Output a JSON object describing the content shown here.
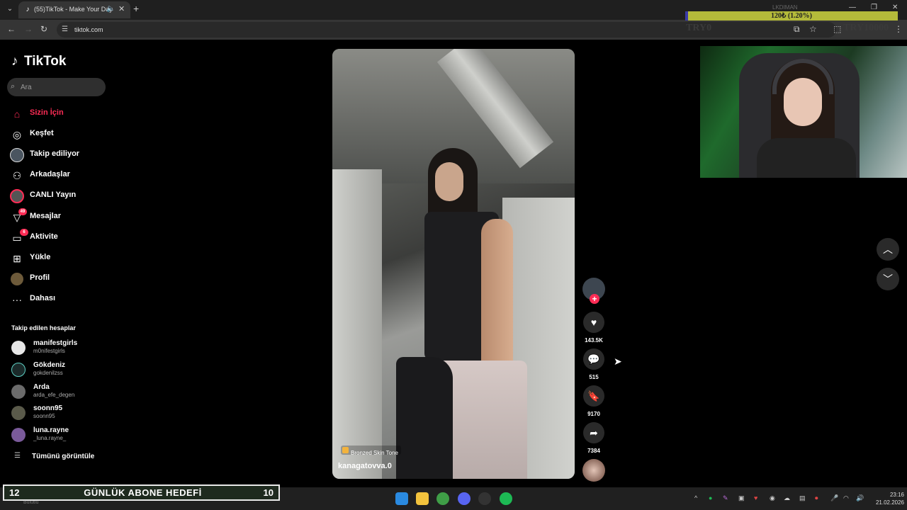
{
  "browser": {
    "tab_title": "(55)TikTok - Make Your Day",
    "url": "tiktok.com",
    "new_tab": "+",
    "minimize": "—",
    "maximize": "❐",
    "close": "✕"
  },
  "overlay": {
    "goal_label": "120₺ (1.20%)",
    "goal_progress": 0.012,
    "goal_top_label": "LKDIMAN",
    "goal_start": "TRY0",
    "goal_end": "TRY10000"
  },
  "sidebar": {
    "logo_text": "TikTok",
    "search_placeholder": "Ara",
    "nav": [
      {
        "label": "Sizin İçin",
        "icon": "home-icon",
        "active": true
      },
      {
        "label": "Keşfet",
        "icon": "compass-icon"
      },
      {
        "label": "Takip ediliyor",
        "icon": "following-avatar-icon"
      },
      {
        "label": "Arkadaşlar",
        "icon": "friends-icon"
      },
      {
        "label": "CANLI Yayın",
        "icon": "live-icon"
      },
      {
        "label": "Mesajlar",
        "icon": "messages-icon",
        "badge": "49"
      },
      {
        "label": "Aktivite",
        "icon": "activity-icon",
        "badge": "6"
      },
      {
        "label": "Yükle",
        "icon": "upload-icon"
      },
      {
        "label": "Profil",
        "icon": "profile-avatar-icon"
      },
      {
        "label": "Dahası",
        "icon": "more-icon"
      }
    ],
    "following_title": "Takip edilen hesaplar",
    "accounts": [
      {
        "name": "manifestgirls",
        "handle": "m0nifestgirls"
      },
      {
        "name": "Gökdeniz",
        "handle": "gokdenilzss"
      },
      {
        "name": "Arda",
        "handle": "arda_efe_degen"
      },
      {
        "name": "soonn95",
        "handle": "soonn95"
      },
      {
        "name": "luna.rayne",
        "handle": "_luna.rayne_"
      }
    ],
    "see_all": "Tümünü görüntüle"
  },
  "video": {
    "effect_label": "Bronzed Skin Tone",
    "author": "kanagatovva.0",
    "likes": "143.5K",
    "comments": "515",
    "saves": "9170",
    "shares": "7384"
  },
  "stream": {
    "subgoal_current": "12",
    "subgoal_title": "GÜNLÜK ABONE HEDEFİ",
    "subgoal_target": "10",
    "weather_text": "Bulutlu"
  },
  "taskbar": {
    "time": "23:16",
    "date": "21.02.2026"
  },
  "colors": {
    "accent": "#fe2c55",
    "goal_bar": "#b4ba3a",
    "goal_fill": "#3a3aa8"
  }
}
